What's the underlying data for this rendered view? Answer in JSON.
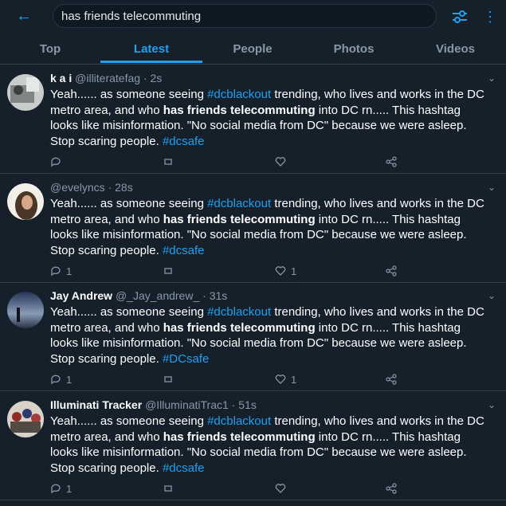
{
  "search": {
    "query": "has friends telecommuting"
  },
  "tabs": [
    "Top",
    "Latest",
    "People",
    "Photos",
    "Videos"
  ],
  "tweets": [
    {
      "name": "k a i",
      "handle": "@illiteratefag",
      "time": "2s",
      "text": {
        "p1": "Yeah...... as someone seeing ",
        "hashtag1": "#dcblackout",
        "p2": " trending, who lives and works in the DC metro area, and who ",
        "bold": "has friends telecommuting",
        "p3": " into DC rn..... This hashtag looks like misinformation. \"No social media from DC\" because we were asleep. Stop scaring people. ",
        "hashtag2": "#dcsafe"
      },
      "replies": "",
      "likes": ""
    },
    {
      "name": "",
      "handle": "@evelyncs",
      "time": "28s",
      "text": {
        "p1": "Yeah...... as someone seeing ",
        "hashtag1": "#dcblackout",
        "p2": " trending, who lives and works in the DC metro area, and who ",
        "bold": "has friends telecommuting",
        "p3": " into DC rn..... This hashtag looks like misinformation. \"No social media from DC\" because we were asleep. Stop scaring people. ",
        "hashtag2": "#dcsafe"
      },
      "replies": "1",
      "likes": "1"
    },
    {
      "name": "Jay Andrew",
      "handle": "@_Jay_andrew_",
      "time": "31s",
      "text": {
        "p1": "Yeah...... as someone seeing ",
        "hashtag1": "#dcblackout",
        "p2": " trending, who lives and works in the DC metro area, and who ",
        "bold": "has friends telecommuting",
        "p3": " into DC rn..... This hashtag looks like misinformation. \"No social media from DC\" because we were asleep. Stop scaring people. ",
        "hashtag2": "#DCsafe"
      },
      "replies": "1",
      "likes": "1"
    },
    {
      "name": "Illuminati Tracker",
      "handle": "@IlluminatiTrac1",
      "time": "51s",
      "text": {
        "p1": "Yeah...... as someone seeing ",
        "hashtag1": "#dcblackout",
        "p2": " trending, who lives and works in the DC metro area, and who ",
        "bold": "has friends telecommuting",
        "p3": " into DC rn..... This hashtag looks like misinformation. \"No social media from DC\" because we were asleep. Stop scaring people. ",
        "hashtag2": "#dcsafe"
      },
      "replies": "1",
      "likes": ""
    }
  ],
  "colors": {
    "accent": "#1da1f2",
    "background": "#15202b",
    "muted": "#8899a6",
    "divider": "#38444d"
  }
}
